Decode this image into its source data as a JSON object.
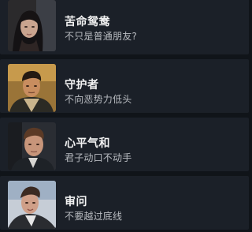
{
  "options": [
    {
      "title": "苦命鸳鸯",
      "subtitle": "不只是普通朋友?",
      "avatar_icon": "woman-portrait-icon"
    },
    {
      "title": "守护者",
      "subtitle": "不向恶势力低头",
      "avatar_icon": "man-uniform-portrait-icon"
    },
    {
      "title": "心平气和",
      "subtitle": "君子动口不动手",
      "avatar_icon": "man-suit-portrait-icon"
    },
    {
      "title": "审问",
      "subtitle": "不要越过底线",
      "avatar_icon": "man-interrogated-portrait-icon"
    }
  ],
  "colors": {
    "background": "#101419",
    "card": "#1b2028",
    "title": "#f2f2f2",
    "subtitle": "#b9bcc1"
  }
}
